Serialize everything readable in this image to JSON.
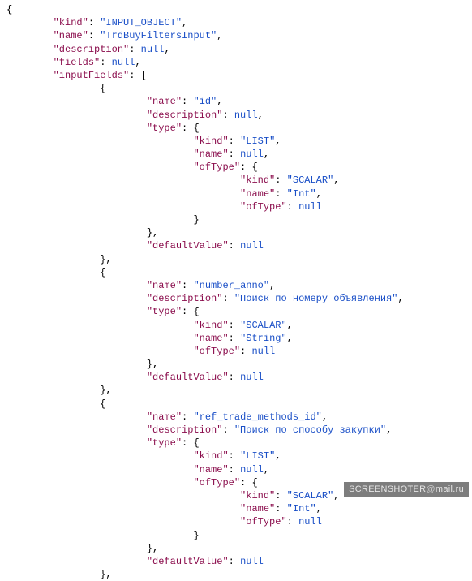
{
  "watermark": {
    "prefix": "SCREENSHOTER",
    "at": "@",
    "suffix": "mail.ru"
  },
  "lines": [
    {
      "indent": 0,
      "tokens": [
        {
          "t": "p",
          "v": "{"
        }
      ]
    },
    {
      "indent": 2,
      "tokens": [
        {
          "t": "k",
          "v": "\"kind\""
        },
        {
          "t": "p",
          "v": ": "
        },
        {
          "t": "s",
          "v": "\"INPUT_OBJECT\""
        },
        {
          "t": "p",
          "v": ","
        }
      ]
    },
    {
      "indent": 2,
      "tokens": [
        {
          "t": "k",
          "v": "\"name\""
        },
        {
          "t": "p",
          "v": ": "
        },
        {
          "t": "s",
          "v": "\"TrdBuyFiltersInput\""
        },
        {
          "t": "p",
          "v": ","
        }
      ]
    },
    {
      "indent": 2,
      "tokens": [
        {
          "t": "k",
          "v": "\"description\""
        },
        {
          "t": "p",
          "v": ": "
        },
        {
          "t": "n",
          "v": "null"
        },
        {
          "t": "p",
          "v": ","
        }
      ]
    },
    {
      "indent": 2,
      "tokens": [
        {
          "t": "k",
          "v": "\"fields\""
        },
        {
          "t": "p",
          "v": ": "
        },
        {
          "t": "n",
          "v": "null"
        },
        {
          "t": "p",
          "v": ","
        }
      ]
    },
    {
      "indent": 2,
      "tokens": [
        {
          "t": "k",
          "v": "\"inputFields\""
        },
        {
          "t": "p",
          "v": ": ["
        }
      ]
    },
    {
      "indent": 4,
      "tokens": [
        {
          "t": "p",
          "v": "{"
        }
      ]
    },
    {
      "indent": 6,
      "tokens": [
        {
          "t": "k",
          "v": "\"name\""
        },
        {
          "t": "p",
          "v": ": "
        },
        {
          "t": "s",
          "v": "\"id\""
        },
        {
          "t": "p",
          "v": ","
        }
      ]
    },
    {
      "indent": 6,
      "tokens": [
        {
          "t": "k",
          "v": "\"description\""
        },
        {
          "t": "p",
          "v": ": "
        },
        {
          "t": "n",
          "v": "null"
        },
        {
          "t": "p",
          "v": ","
        }
      ]
    },
    {
      "indent": 6,
      "tokens": [
        {
          "t": "k",
          "v": "\"type\""
        },
        {
          "t": "p",
          "v": ": {"
        }
      ]
    },
    {
      "indent": 8,
      "tokens": [
        {
          "t": "k",
          "v": "\"kind\""
        },
        {
          "t": "p",
          "v": ": "
        },
        {
          "t": "s",
          "v": "\"LIST\""
        },
        {
          "t": "p",
          "v": ","
        }
      ]
    },
    {
      "indent": 8,
      "tokens": [
        {
          "t": "k",
          "v": "\"name\""
        },
        {
          "t": "p",
          "v": ": "
        },
        {
          "t": "n",
          "v": "null"
        },
        {
          "t": "p",
          "v": ","
        }
      ]
    },
    {
      "indent": 8,
      "tokens": [
        {
          "t": "k",
          "v": "\"ofType\""
        },
        {
          "t": "p",
          "v": ": {"
        }
      ]
    },
    {
      "indent": 10,
      "tokens": [
        {
          "t": "k",
          "v": "\"kind\""
        },
        {
          "t": "p",
          "v": ": "
        },
        {
          "t": "s",
          "v": "\"SCALAR\""
        },
        {
          "t": "p",
          "v": ","
        }
      ]
    },
    {
      "indent": 10,
      "tokens": [
        {
          "t": "k",
          "v": "\"name\""
        },
        {
          "t": "p",
          "v": ": "
        },
        {
          "t": "s",
          "v": "\"Int\""
        },
        {
          "t": "p",
          "v": ","
        }
      ]
    },
    {
      "indent": 10,
      "tokens": [
        {
          "t": "k",
          "v": "\"ofType\""
        },
        {
          "t": "p",
          "v": ": "
        },
        {
          "t": "n",
          "v": "null"
        }
      ]
    },
    {
      "indent": 8,
      "tokens": [
        {
          "t": "p",
          "v": "}"
        }
      ]
    },
    {
      "indent": 6,
      "tokens": [
        {
          "t": "p",
          "v": "},"
        }
      ]
    },
    {
      "indent": 6,
      "tokens": [
        {
          "t": "k",
          "v": "\"defaultValue\""
        },
        {
          "t": "p",
          "v": ": "
        },
        {
          "t": "n",
          "v": "null"
        }
      ]
    },
    {
      "indent": 4,
      "tokens": [
        {
          "t": "p",
          "v": "},"
        }
      ]
    },
    {
      "indent": 4,
      "tokens": [
        {
          "t": "p",
          "v": "{"
        }
      ]
    },
    {
      "indent": 6,
      "tokens": [
        {
          "t": "k",
          "v": "\"name\""
        },
        {
          "t": "p",
          "v": ": "
        },
        {
          "t": "s",
          "v": "\"number_anno\""
        },
        {
          "t": "p",
          "v": ","
        }
      ]
    },
    {
      "indent": 6,
      "tokens": [
        {
          "t": "k",
          "v": "\"description\""
        },
        {
          "t": "p",
          "v": ": "
        },
        {
          "t": "s",
          "v": "\"Поиск по номеру объявления\""
        },
        {
          "t": "p",
          "v": ","
        }
      ]
    },
    {
      "indent": 6,
      "tokens": [
        {
          "t": "k",
          "v": "\"type\""
        },
        {
          "t": "p",
          "v": ": {"
        }
      ]
    },
    {
      "indent": 8,
      "tokens": [
        {
          "t": "k",
          "v": "\"kind\""
        },
        {
          "t": "p",
          "v": ": "
        },
        {
          "t": "s",
          "v": "\"SCALAR\""
        },
        {
          "t": "p",
          "v": ","
        }
      ]
    },
    {
      "indent": 8,
      "tokens": [
        {
          "t": "k",
          "v": "\"name\""
        },
        {
          "t": "p",
          "v": ": "
        },
        {
          "t": "s",
          "v": "\"String\""
        },
        {
          "t": "p",
          "v": ","
        }
      ]
    },
    {
      "indent": 8,
      "tokens": [
        {
          "t": "k",
          "v": "\"ofType\""
        },
        {
          "t": "p",
          "v": ": "
        },
        {
          "t": "n",
          "v": "null"
        }
      ]
    },
    {
      "indent": 6,
      "tokens": [
        {
          "t": "p",
          "v": "},"
        }
      ]
    },
    {
      "indent": 6,
      "tokens": [
        {
          "t": "k",
          "v": "\"defaultValue\""
        },
        {
          "t": "p",
          "v": ": "
        },
        {
          "t": "n",
          "v": "null"
        }
      ]
    },
    {
      "indent": 4,
      "tokens": [
        {
          "t": "p",
          "v": "},"
        }
      ]
    },
    {
      "indent": 4,
      "tokens": [
        {
          "t": "p",
          "v": "{"
        }
      ]
    },
    {
      "indent": 6,
      "tokens": [
        {
          "t": "k",
          "v": "\"name\""
        },
        {
          "t": "p",
          "v": ": "
        },
        {
          "t": "s",
          "v": "\"ref_trade_methods_id\""
        },
        {
          "t": "p",
          "v": ","
        }
      ]
    },
    {
      "indent": 6,
      "tokens": [
        {
          "t": "k",
          "v": "\"description\""
        },
        {
          "t": "p",
          "v": ": "
        },
        {
          "t": "s",
          "v": "\"Поиск по способу закупки\""
        },
        {
          "t": "p",
          "v": ","
        }
      ]
    },
    {
      "indent": 6,
      "tokens": [
        {
          "t": "k",
          "v": "\"type\""
        },
        {
          "t": "p",
          "v": ": {"
        }
      ]
    },
    {
      "indent": 8,
      "tokens": [
        {
          "t": "k",
          "v": "\"kind\""
        },
        {
          "t": "p",
          "v": ": "
        },
        {
          "t": "s",
          "v": "\"LIST\""
        },
        {
          "t": "p",
          "v": ","
        }
      ]
    },
    {
      "indent": 8,
      "tokens": [
        {
          "t": "k",
          "v": "\"name\""
        },
        {
          "t": "p",
          "v": ": "
        },
        {
          "t": "n",
          "v": "null"
        },
        {
          "t": "p",
          "v": ","
        }
      ]
    },
    {
      "indent": 8,
      "tokens": [
        {
          "t": "k",
          "v": "\"ofType\""
        },
        {
          "t": "p",
          "v": ": {"
        }
      ]
    },
    {
      "indent": 10,
      "tokens": [
        {
          "t": "k",
          "v": "\"kind\""
        },
        {
          "t": "p",
          "v": ": "
        },
        {
          "t": "s",
          "v": "\"SCALAR\""
        },
        {
          "t": "p",
          "v": ","
        }
      ]
    },
    {
      "indent": 10,
      "tokens": [
        {
          "t": "k",
          "v": "\"name\""
        },
        {
          "t": "p",
          "v": ": "
        },
        {
          "t": "s",
          "v": "\"Int\""
        },
        {
          "t": "p",
          "v": ","
        }
      ]
    },
    {
      "indent": 10,
      "tokens": [
        {
          "t": "k",
          "v": "\"ofType\""
        },
        {
          "t": "p",
          "v": ": "
        },
        {
          "t": "n",
          "v": "null"
        }
      ]
    },
    {
      "indent": 8,
      "tokens": [
        {
          "t": "p",
          "v": "}"
        }
      ]
    },
    {
      "indent": 6,
      "tokens": [
        {
          "t": "p",
          "v": "},"
        }
      ]
    },
    {
      "indent": 6,
      "tokens": [
        {
          "t": "k",
          "v": "\"defaultValue\""
        },
        {
          "t": "p",
          "v": ": "
        },
        {
          "t": "n",
          "v": "null"
        }
      ]
    },
    {
      "indent": 4,
      "tokens": [
        {
          "t": "p",
          "v": "},"
        }
      ]
    }
  ]
}
